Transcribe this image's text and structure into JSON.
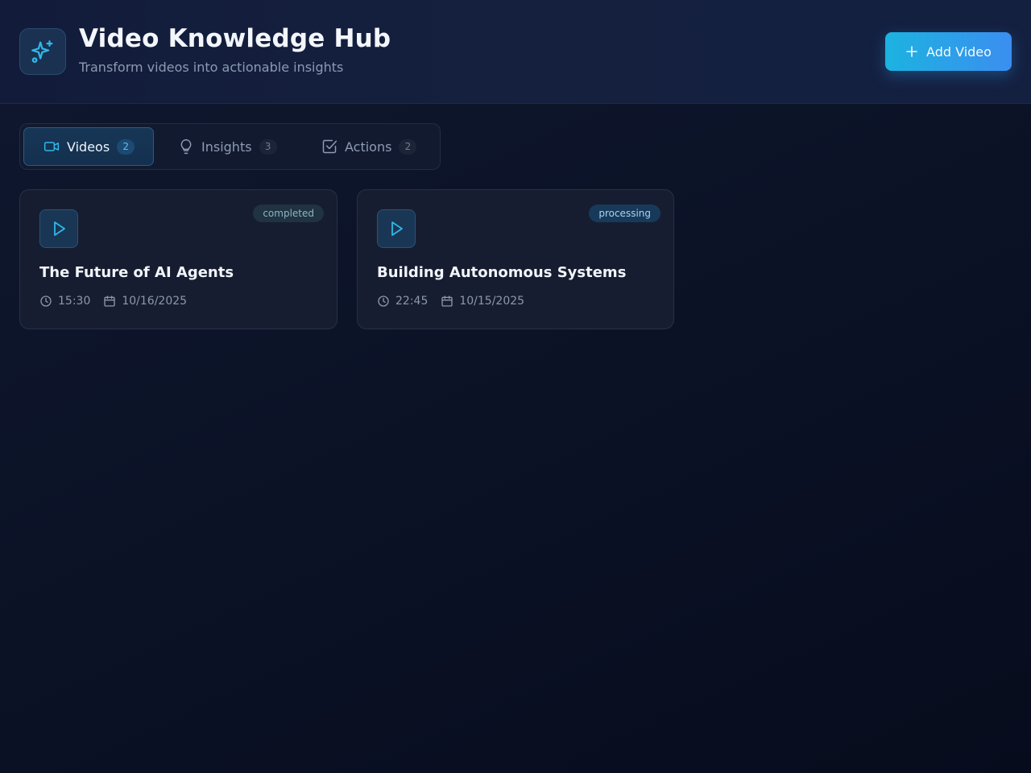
{
  "app": {
    "title": "Video Knowledge Hub",
    "subtitle": "Transform videos into actionable insights",
    "logo_icon": "sparkles-icon",
    "add_video_label": "Add Video"
  },
  "tabs": [
    {
      "label": "Videos",
      "count": "2",
      "icon": "video-camera-icon",
      "active": true
    },
    {
      "label": "Insights",
      "count": "3",
      "icon": "lightbulb-icon",
      "active": false
    },
    {
      "label": "Actions",
      "count": "2",
      "icon": "check-square-icon",
      "active": false
    }
  ],
  "videos": [
    {
      "title": "The Future of AI Agents",
      "status": "completed",
      "duration": "15:30",
      "date": "10/16/2025"
    },
    {
      "title": "Building Autonomous Systems",
      "status": "processing",
      "duration": "22:45",
      "date": "10/15/2025"
    }
  ],
  "colors": {
    "accent": "#22b8e6",
    "button_gradient_start": "#1cb3e0",
    "button_gradient_end": "#3b8ef0",
    "background": "#0b1124"
  }
}
